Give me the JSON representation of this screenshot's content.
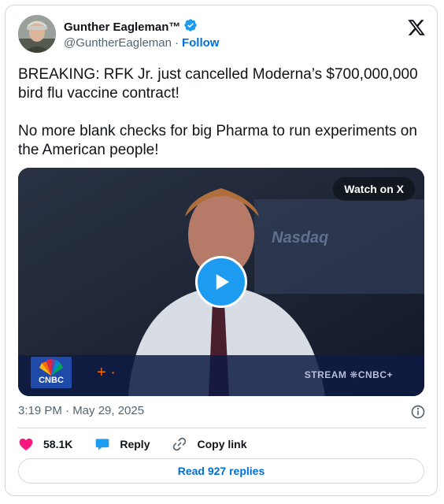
{
  "author": {
    "display_name": "Gunther Eagleman™",
    "handle": "@GuntherEagleman",
    "separator": "·",
    "follow_label": "Follow"
  },
  "tweet": {
    "text": "BREAKING: RFK Jr. just cancelled Moderna’s $700,000,000 bird flu vaccine contract!\n\nNo more blank checks for big Pharma to run experiments on the American people!"
  },
  "media": {
    "watch_label": "Watch on X",
    "nasdaq_text": "Nasdaq",
    "cnbc_logo_text": "CNBC",
    "stream_text": "STREAM ❋CNBC+"
  },
  "timestamp": "3:19 PM · May 29, 2025",
  "actions": {
    "likes_count": "58.1K",
    "reply_label": "Reply",
    "copy_link_label": "Copy link"
  },
  "read_replies_label": "Read 927 replies",
  "colors": {
    "accent": "#006fd6",
    "play_button": "#1d9bf0",
    "like": "#f91880",
    "verified": "#1d9bf0"
  }
}
